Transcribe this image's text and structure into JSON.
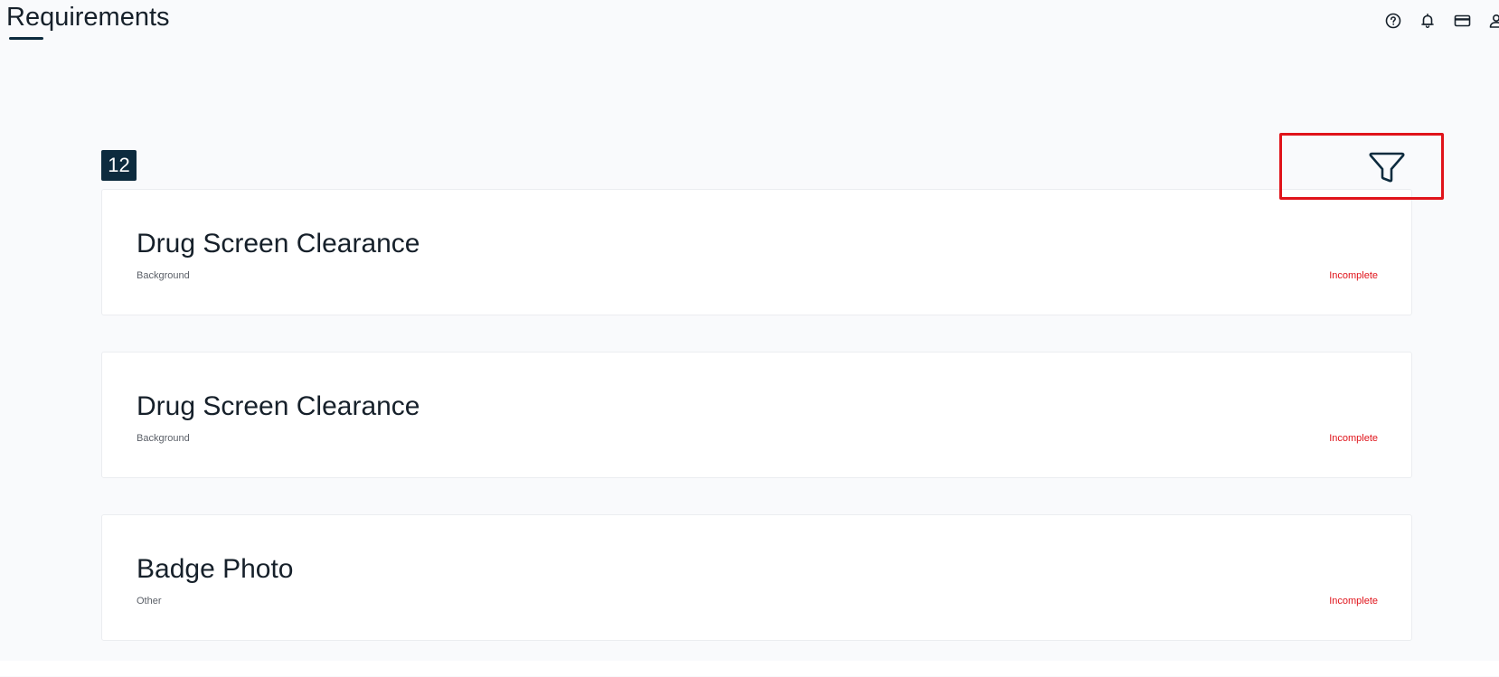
{
  "header": {
    "title": "Requirements",
    "icons": [
      "help-icon",
      "bell-icon",
      "credit-card-icon",
      "user-icon"
    ]
  },
  "summary": {
    "count": "12"
  },
  "filter": {
    "icon": "filter-icon",
    "highlight_color": "#e0131a"
  },
  "requirements": [
    {
      "title": "Drug Screen Clearance",
      "category": "Background",
      "status": "Incomplete"
    },
    {
      "title": "Drug Screen Clearance",
      "category": "Background",
      "status": "Incomplete"
    },
    {
      "title": "Badge Photo",
      "category": "Other",
      "status": "Incomplete"
    }
  ],
  "colors": {
    "brand_dark": "#0d2b3e",
    "status_incomplete": "#e0131a",
    "background": "#f9fafc"
  }
}
